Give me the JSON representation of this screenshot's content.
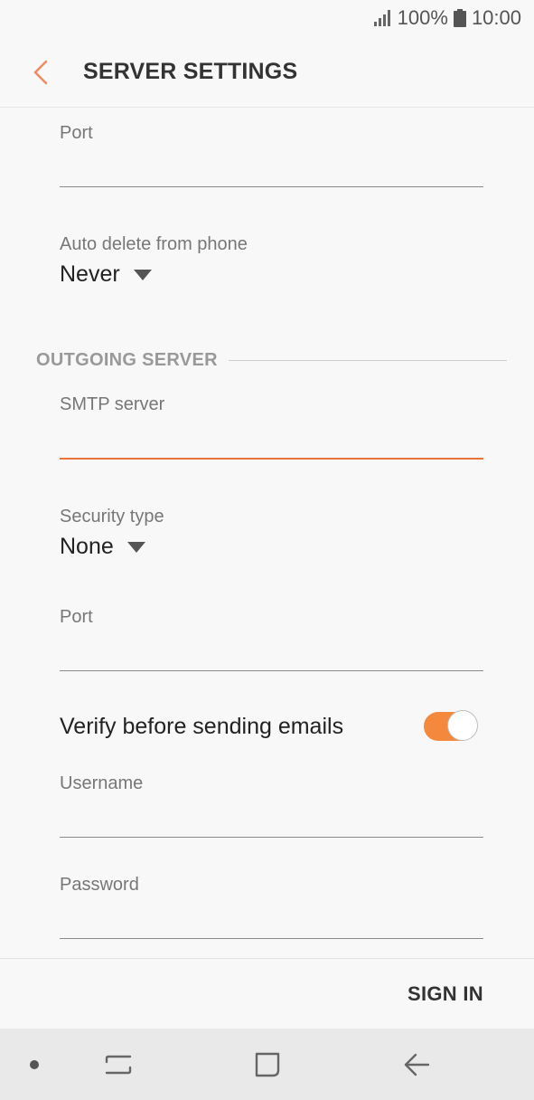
{
  "status_bar": {
    "battery": "100%",
    "time": "10:00"
  },
  "app_bar": {
    "title": "SERVER SETTINGS"
  },
  "incoming": {
    "port_label": "Port",
    "port_value": "",
    "auto_delete_label": "Auto delete from phone",
    "auto_delete_value": "Never"
  },
  "outgoing": {
    "section_title": "OUTGOING SERVER",
    "smtp_label": "SMTP server",
    "smtp_value": "",
    "security_label": "Security type",
    "security_value": "None",
    "port_label": "Port",
    "port_value": "",
    "verify_label": "Verify before sending emails",
    "verify_on": true,
    "username_label": "Username",
    "username_value": "",
    "password_label": "Password",
    "password_value": ""
  },
  "actions": {
    "sign_in": "SIGN IN"
  },
  "colors": {
    "accent": "#f4893e",
    "focus_underline": "#e8743b",
    "back_arrow": "#ef8c5e"
  }
}
